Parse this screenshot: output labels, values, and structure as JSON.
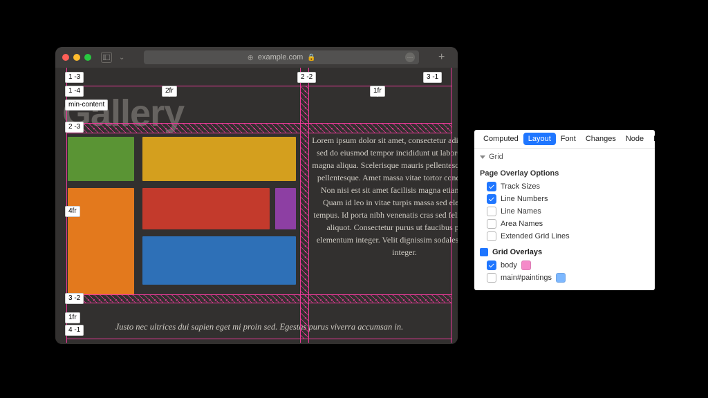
{
  "safari": {
    "url_host": "example.com"
  },
  "page": {
    "title": "Gallery",
    "lorem": "Lorem ipsum dolor sit amet, consectetur adipiscing elit, sed do eiusmod tempor incididunt ut labore et dolore magna aliqua. Scelerisque mauris pellentesque pulvinar pellentesque. Amet massa vitae tortor condimentum. Non nisi est sit amet facilisis magna etiam tempor. Quam id leo in vitae turpis massa sed elementum tempus. Id porta nibh venenatis cras sed felis eget velit aliquot. Consectetur purus ut faucibus pulvinar elementum integer. Velit dignissim sodales ut eu sem integer.",
    "footer": "Justo nec ultrices dui sapien eget mi proin sed. Egestas purus viverra accumsan in."
  },
  "grid_overlay": {
    "badges": {
      "tl_col_line": "1  -3",
      "row1_start": "1  -4",
      "row1_size": "min-content",
      "col1_size": "2fr",
      "col2_line": "2  -2",
      "col2_size": "1fr",
      "col3_line": "3  -1",
      "row2_start": "2  -3",
      "row2_size": "4fr",
      "row3_start": "3  -2",
      "row3_size": "1fr",
      "row4_start": "4  -1"
    }
  },
  "devtools": {
    "tabs": {
      "computed": "Computed",
      "layout": "Layout",
      "font": "Font",
      "changes": "Changes",
      "node": "Node",
      "layers": "Layers"
    },
    "grid_section_label": "Grid",
    "page_overlay_options": "Page Overlay Options",
    "options": {
      "track_sizes": "Track Sizes",
      "line_numbers": "Line Numbers",
      "line_names": "Line Names",
      "area_names": "Area Names",
      "extended_grid_lines": "Extended Grid Lines"
    },
    "grid_overlays": "Grid Overlays",
    "overlays": {
      "body": "body",
      "main": "main#paintings"
    },
    "colors": {
      "body_swatch": "#f58bc9",
      "main_swatch": "#7db8ff"
    }
  }
}
